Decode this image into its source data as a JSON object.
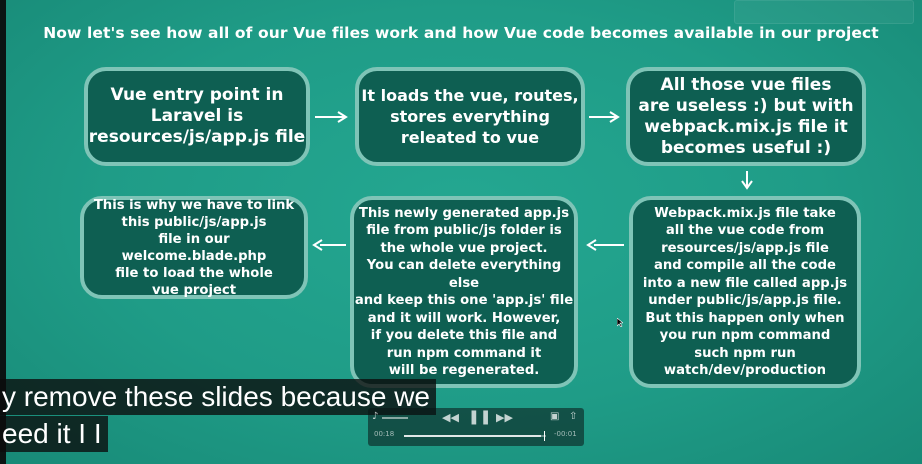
{
  "slide": {
    "title": "Now let's see how all of  our Vue files work and how Vue code becomes available in our project",
    "boxes": [
      "Vue entry point in\nLaravel is\nresources/js/app.js file",
      "It loads the vue, routes,\nstores everything\nreleated to vue",
      "All those vue files\nare useless :) but with\nwebpack.mix.js file it\nbecomes useful :)",
      "Webpack.mix.js file take\nall the vue code from\nresources/js/app.js file\nand compile all the code\ninto a new file called app.js\nunder public/js/app.js file.\nBut this happen only when\nyou run npm command\nsuch npm run\nwatch/dev/production",
      "This newly generated app.js\nfile from public/js folder is\nthe whole vue project.\nYou can delete everything\nelse\nand keep this one 'app.js' file\nand it will work. However,\nif you delete this file and\nrun npm command it\nwill be regenerated.",
      "This is why we have to link\nthis public/js/app.js\nfile in our welcome.blade.php\nfile to load the whole\nvue project"
    ]
  },
  "captions": {
    "line1": "y remove these slides because we",
    "line2": "eed it I I"
  },
  "player": {
    "current_time": "00:18",
    "remaining_time": "-00:01"
  },
  "colors": {
    "background": "#1f9c87",
    "box_fill": "#0e5f52",
    "box_border": "#7fc4b7"
  }
}
